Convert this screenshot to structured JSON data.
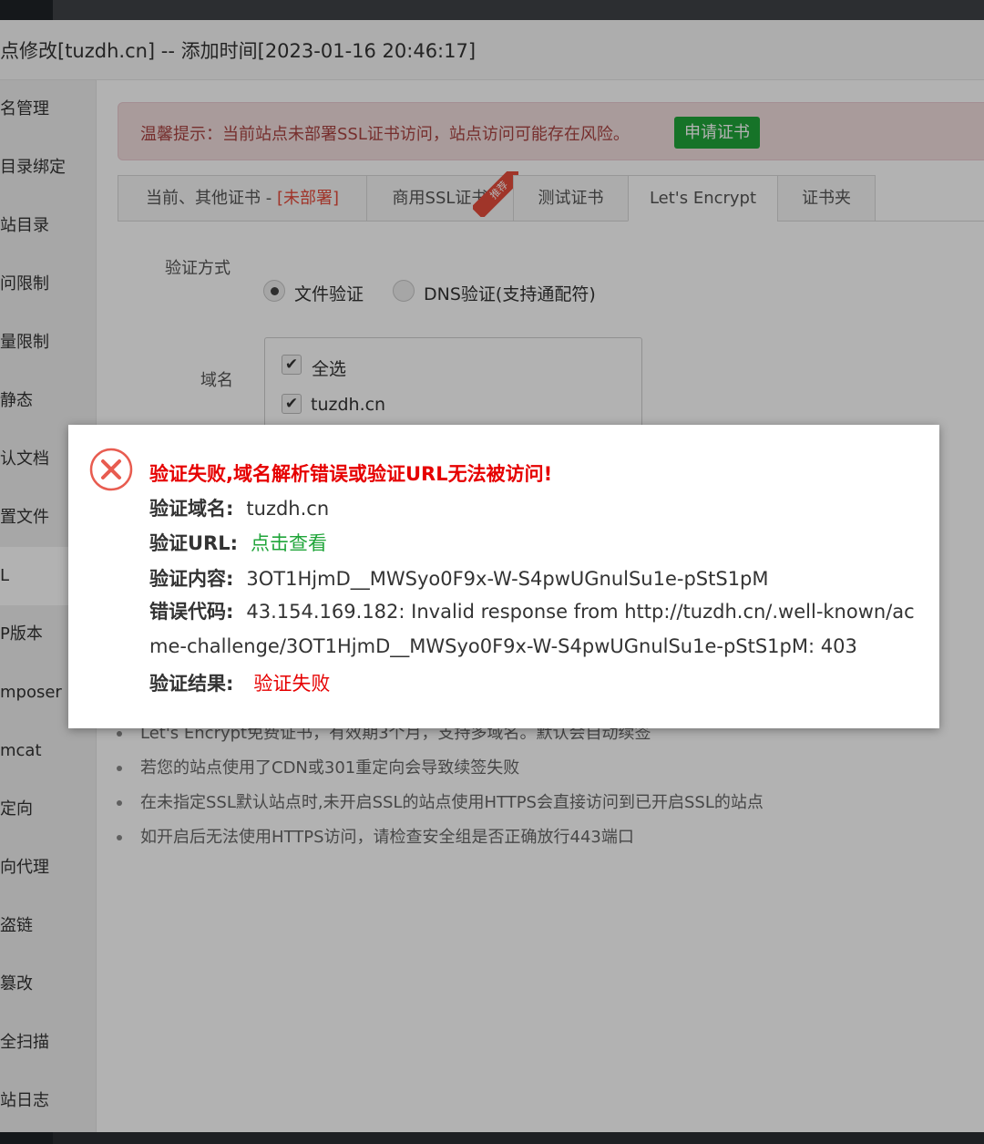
{
  "window_title": "点修改[tuzdh.cn] -- 添加时间[2023-01-16 20:46:17]",
  "sidebar": {
    "items": [
      {
        "label": "名管理"
      },
      {
        "label": "目录绑定"
      },
      {
        "label": "站目录"
      },
      {
        "label": "问限制"
      },
      {
        "label": "量限制"
      },
      {
        "label": "静态"
      },
      {
        "label": "认文档"
      },
      {
        "label": "置文件"
      },
      {
        "label": "L"
      },
      {
        "label": "P版本"
      },
      {
        "label": "mposer"
      },
      {
        "label": "mcat"
      },
      {
        "label": "定向"
      },
      {
        "label": "向代理"
      },
      {
        "label": "盗链"
      },
      {
        "label": "篡改"
      },
      {
        "label": "全扫描"
      },
      {
        "label": "站日志"
      }
    ]
  },
  "alert": {
    "text": "温馨提示：当前站点未部署SSL证书访问，站点访问可能存在风险。",
    "button": "申请证书"
  },
  "tabs": {
    "t1_label": "当前、其他证书 - ",
    "t1_status": "[未部署]",
    "t2_label": "商用SSL证书",
    "t2_ribbon": "推荐",
    "t3_label": "测试证书",
    "t4_label": "Let's Encrypt",
    "t5_label": "证书夹"
  },
  "form": {
    "verify_label": "验证方式",
    "opt_file": "文件验证",
    "opt_dns": "DNS验证(支持通配符)",
    "domain_label": "域名",
    "select_all": "全选",
    "domain": "tuzdh.cn"
  },
  "tips": [
    "Let's Encrypt免费证书，有效期3个月，支持多域名。默认会自动续签",
    "若您的站点使用了CDN或301重定向会导致续签失败",
    "在未指定SSL默认站点时,未开启SSL的站点使用HTTPS会直接访问到已开启SSL的站点",
    "如开启后无法使用HTTPS访问，请检查安全组是否正确放行443端口"
  ],
  "dialog": {
    "title": "验证失败,域名解析错误或验证URL无法被访问!",
    "domain_key": "验证域名:",
    "domain_val": "tuzdh.cn",
    "url_key": "验证URL:",
    "url_val": "点击查看",
    "content_key": "验证内容:",
    "content_val": "3OT1HjmD__MWSyo0F9x-W-S4pwUGnulSu1e-pStS1pM",
    "code_key": "错误代码:",
    "code_val": "43.154.169.182: Invalid response from http://tuzdh.cn/.well-known/acme-challenge/3OT1HjmD__MWSyo0F9x-W-S4pwUGnulSu1e-pStS1pM: 403",
    "result_key": "验证结果:",
    "result_val": "验证失败"
  },
  "colors": {
    "accent_green": "#20a53a",
    "error_red": "#e60000",
    "alert_bg": "#f2dede"
  }
}
